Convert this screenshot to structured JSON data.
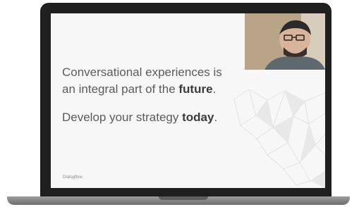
{
  "slide": {
    "line1": "Conversational experiences is",
    "line2_prefix": "an integral part of the ",
    "line2_bold": "future",
    "line2_suffix": ".",
    "line3_prefix": "Develop your strategy ",
    "line3_bold": "today",
    "line3_suffix": ".",
    "brand": "Dialogflow"
  },
  "icons": {
    "webcam": "person-video-icon",
    "mesh": "network-mesh-icon"
  },
  "colors": {
    "device": "#1f1f1f",
    "screen": "#f7f7f7",
    "text": "#5b5b5b"
  }
}
